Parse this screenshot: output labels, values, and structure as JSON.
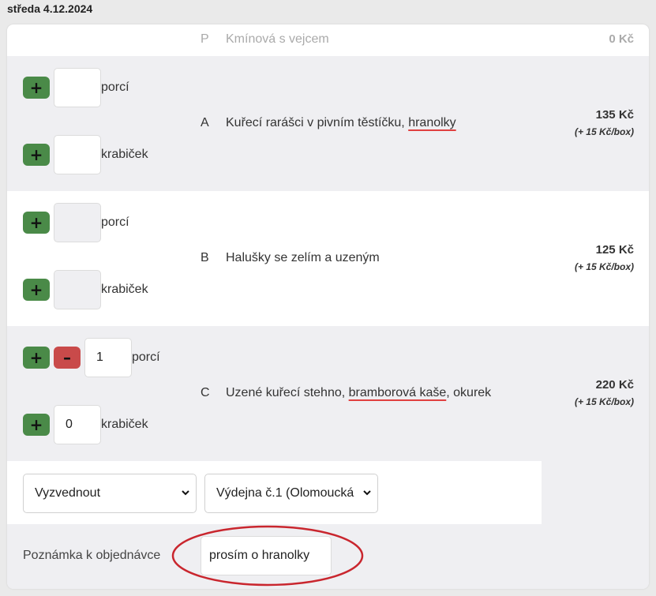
{
  "date_heading": "středa 4.12.2024",
  "menu": {
    "soup": {
      "letter": "P",
      "name": "Kmínová s vejcem",
      "price": "0 Kč"
    },
    "items": [
      {
        "letter": "A",
        "name_parts": [
          "Kuřecí rarášci v pivním těstíčku, ",
          "hranolky"
        ],
        "price": "135 Kč",
        "box_note": "(+ 15 Kč/box)",
        "portions_label": "porcí",
        "boxes_label": "krabiček",
        "portions_value": "",
        "boxes_value": ""
      },
      {
        "letter": "B",
        "name_parts": [
          "Halušky se zelím a uzeným"
        ],
        "price": "125 Kč",
        "box_note": "(+ 15 Kč/box)",
        "portions_label": "porcí",
        "boxes_label": "krabiček",
        "portions_value": "",
        "boxes_value": ""
      },
      {
        "letter": "C",
        "name_parts": [
          "Uzené kuřecí stehno, ",
          "bramborová kaše",
          ", okurek"
        ],
        "price": "220 Kč",
        "box_note": "(+ 15 Kč/box)",
        "portions_label": "porcí",
        "boxes_label": "krabiček",
        "portions_value": "1",
        "boxes_value": "0"
      }
    ]
  },
  "buttons": {
    "plus": "+",
    "minus": "–"
  },
  "pickup": {
    "method_selected": "Vyzvednout",
    "location_selected": "Výdejna č.1 (Olomoucká"
  },
  "note": {
    "label": "Poznámka k objednávce",
    "value": "prosím o hranolky"
  },
  "colors": {
    "plus_button": "#4a8a48",
    "minus_button": "#c94a4a",
    "spell_underline": "#e04040",
    "annotation_ellipse": "#c9262e"
  }
}
